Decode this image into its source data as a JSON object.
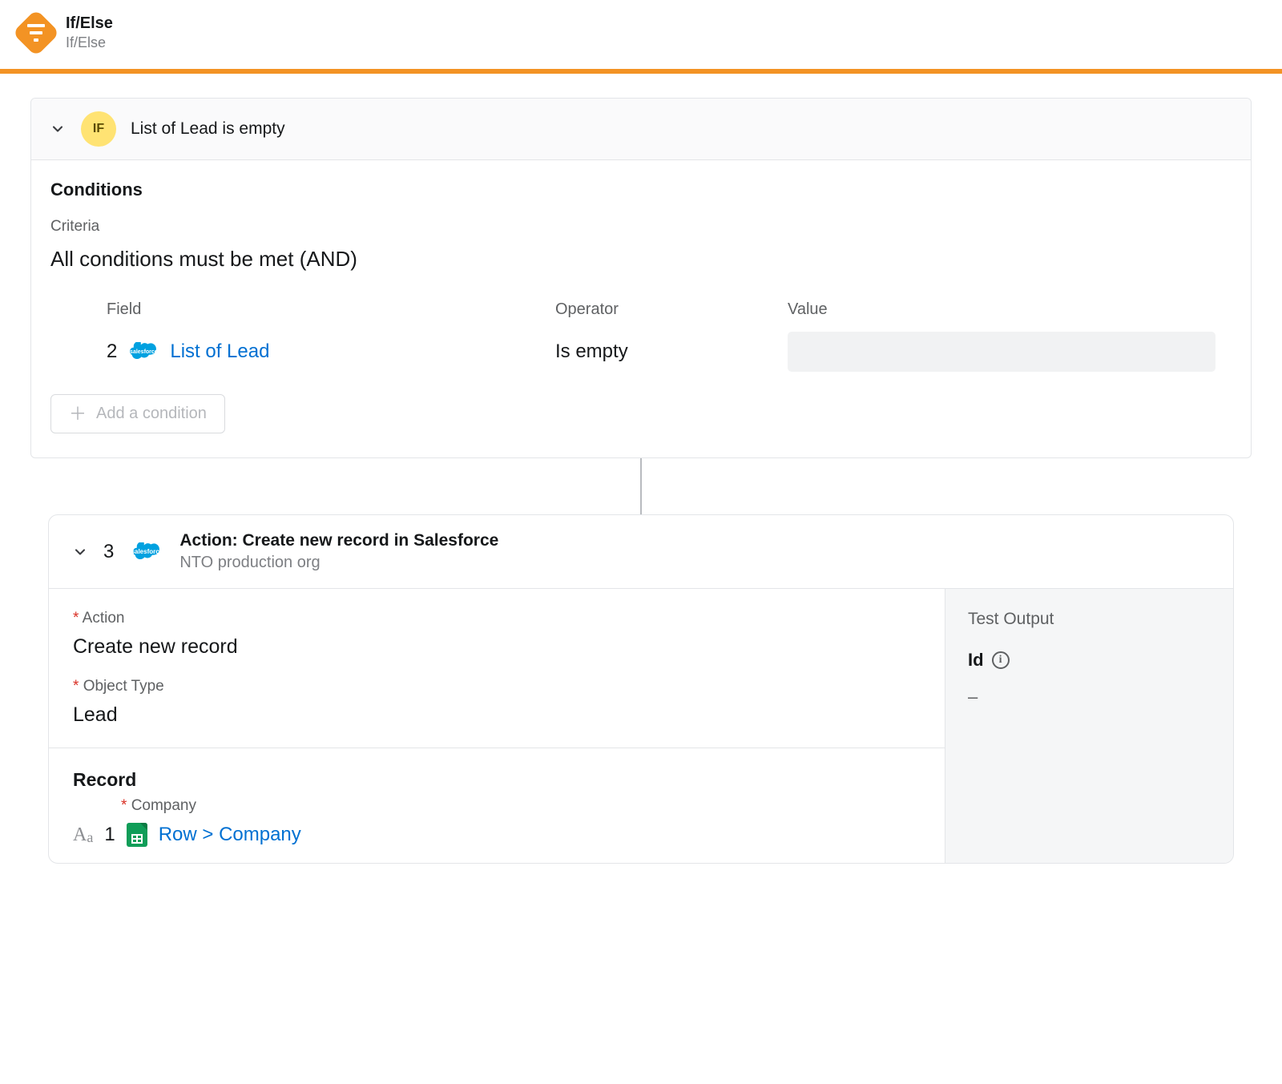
{
  "header": {
    "title": "If/Else",
    "subtitle": "If/Else"
  },
  "ifBlock": {
    "badge": "IF",
    "title": "List of Lead is empty",
    "conditionsHeading": "Conditions",
    "criteriaLabel": "Criteria",
    "criteriaValue": "All conditions must be met (AND)",
    "columns": {
      "field": "Field",
      "operator": "Operator",
      "value": "Value"
    },
    "row": {
      "step": "2",
      "fieldLink": "List of Lead",
      "operator": "Is empty"
    },
    "addCondition": "Add a condition"
  },
  "actionBlock": {
    "step": "3",
    "title": "Action: Create new record in Salesforce",
    "subtitle": "NTO production org",
    "fields": {
      "actionLabel": "Action",
      "actionValue": "Create new record",
      "objectTypeLabel": "Object Type",
      "objectTypeValue": "Lead"
    },
    "record": {
      "heading": "Record",
      "companyLabel": "Company",
      "rowStep": "1",
      "rowLink": "Row > Company"
    },
    "testOutput": {
      "heading": "Test Output",
      "idLabel": "Id",
      "value": "–"
    }
  }
}
